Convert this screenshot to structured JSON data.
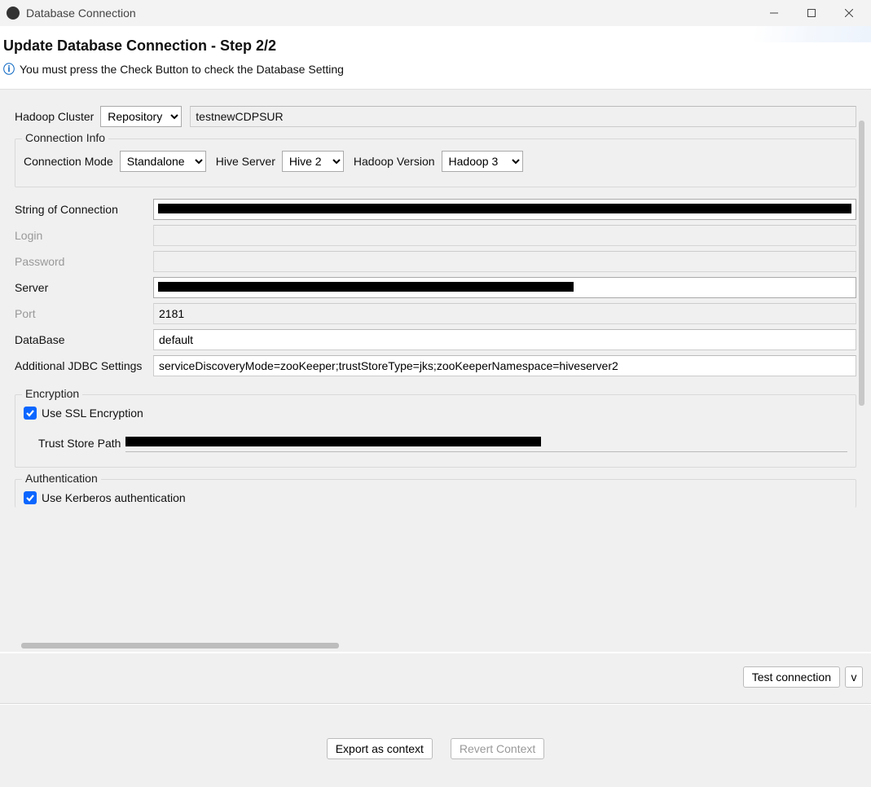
{
  "window": {
    "title": "Database Connection"
  },
  "header": {
    "title": "Update Database Connection - Step 2/2",
    "info": "You must press the Check Button to check the Database Setting"
  },
  "hadoop": {
    "label": "Hadoop Cluster",
    "mode": "Repository",
    "cluster_name": "testnewCDPSUR"
  },
  "conn_info": {
    "legend": "Connection Info",
    "mode_label": "Connection Mode",
    "mode_value": "Standalone",
    "hive_server_label": "Hive Server",
    "hive_server_value": "Hive 2",
    "hadoop_version_label": "Hadoop Version",
    "hadoop_version_value": "Hadoop 3"
  },
  "fields": {
    "string_of_connection": {
      "label": "String of Connection",
      "value": ""
    },
    "login": {
      "label": "Login",
      "value": ""
    },
    "password": {
      "label": "Password",
      "value": ""
    },
    "server": {
      "label": "Server",
      "value": ""
    },
    "port": {
      "label": "Port",
      "value": "2181"
    },
    "database": {
      "label": "DataBase",
      "value": "default"
    },
    "additional_jdbc": {
      "label": "Additional JDBC Settings",
      "value": "serviceDiscoveryMode=zooKeeper;trustStoreType=jks;zooKeeperNamespace=hiveserver2"
    }
  },
  "encryption": {
    "legend": "Encryption",
    "ssl_label": "Use SSL Encryption",
    "ssl_checked": true,
    "trust_store_label": "Trust Store Path",
    "trust_store_value": ""
  },
  "auth": {
    "legend": "Authentication",
    "kerberos_label": "Use Kerberos authentication",
    "kerberos_checked": true
  },
  "buttons": {
    "test": "Test connection",
    "test_dropdown": "v",
    "export": "Export as context",
    "revert": "Revert Context"
  }
}
